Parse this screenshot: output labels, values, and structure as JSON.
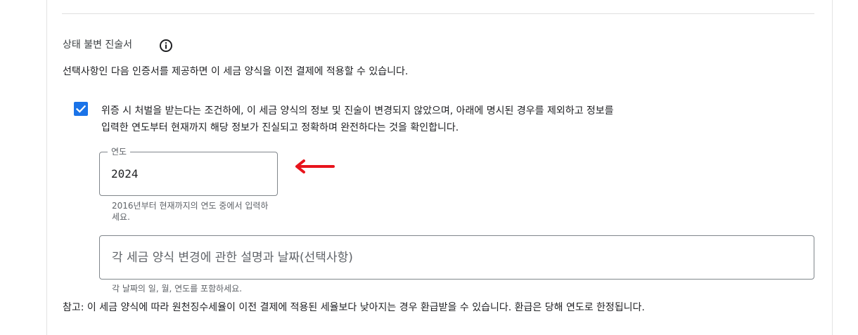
{
  "section": {
    "title": "상태 불변 진술서",
    "description": "선택사항인 다음 인증서를 제공하면 이 세금 양식을 이전 결제에 적용할 수 있습니다.",
    "info_icon": "info-icon"
  },
  "certification": {
    "checked": true,
    "line1": "위증 시 처벌을 받는다는 조건하에, 이 세금 양식의 정보 및 진술이 변경되지 않았으며, 아래에 명시된 경우를 제외하고 정보를",
    "line2": "입력한 연도부터 현재까지 해당 정보가 진실되고 정확하며 완전하다는 것을 확인합니다."
  },
  "year_field": {
    "label": "연도",
    "value": "2024",
    "hint": "2016년부터 현재까지의 연도 중에서 입력하세요."
  },
  "change_field": {
    "placeholder": "각 세금 양식 변경에 관한 설명과 날짜(선택사항)",
    "hint": "각 날짜의 일, 월, 연도를 포함하세요."
  },
  "note": "참고: 이 세금 양식에 따라 원천징수세율이 이전 결제에 적용된 세율보다 낮아지는 경우 환급받을 수 있습니다. 환급은 당해 연도로 한정됩니다.",
  "colors": {
    "accent": "#1a73e8",
    "annotation_arrow": "#e8141c"
  }
}
